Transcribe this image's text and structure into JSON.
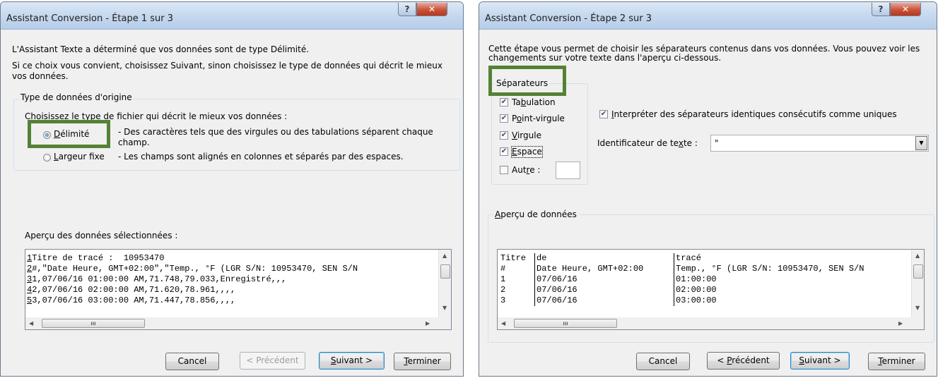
{
  "dialog1": {
    "title": "Assistant Conversion - Étape 1 sur 3",
    "intro1": "L'Assistant Texte a déterminé que vos données sont de type Délimité.",
    "intro2": "Si ce choix vous convient, choisissez Suivant, sinon choisissez le type de données qui décrit le mieux vos données.",
    "group_title": "Type de données d'origine",
    "choose_label": "Choisissez le type de fichier qui décrit le mieux vos données :",
    "option_delimited": {
      "label": "Délimité",
      "desc": "- Des caractères tels que des virgules ou des tabulations séparent chaque champ.",
      "selected": true
    },
    "option_fixed": {
      "label": "Largeur fixe",
      "desc": "- Les champs sont alignés en colonnes et séparés par des espaces.",
      "selected": false
    },
    "preview_label": "Aperçu des données sélectionnées :",
    "preview_rows": [
      {
        "num": "1",
        "text": "Titre de tracé :  10953470"
      },
      {
        "num": "2",
        "text": "#,\"Date Heure, GMT+02:00\",\"Temp., °F (LGR S/N: 10953470, SEN S/N"
      },
      {
        "num": "3",
        "text": "1,07/06/16 01:00:00 AM,71.748,79.033,Enregistré,,,"
      },
      {
        "num": "4",
        "text": "2,07/06/16 02:00:00 AM,71.620,78.961,,,,"
      },
      {
        "num": "5",
        "text": "3,07/06/16 03:00:00 AM,71.447,78.856,,,,"
      }
    ],
    "buttons": {
      "cancel": "Cancel",
      "prev": "< Précédent",
      "next": "Suivant >",
      "finish": "Terminer"
    }
  },
  "dialog2": {
    "title": "Assistant Conversion - Étape 2 sur 3",
    "intro": "Cette étape vous permet de choisir les séparateurs contenus dans vos données. Vous pouvez voir les changements sur votre texte dans l'aperçu ci-dessous.",
    "separators_title": "Séparateurs",
    "separators": [
      {
        "label": "Tabulation",
        "checked": true
      },
      {
        "label": "Point-virgule",
        "checked": true
      },
      {
        "label": "Virgule",
        "checked": true
      },
      {
        "label": "Espace",
        "checked": true
      },
      {
        "label": "Autre :",
        "checked": false
      }
    ],
    "consecutive_label": "Interpréter des séparateurs identiques consécutifs comme uniques",
    "consecutive_checked": true,
    "text_qualifier_label": "Identificateur de texte :",
    "text_qualifier_value": "\"",
    "preview_title": "Aperçu de données",
    "preview_rows": [
      [
        "Titre",
        "de",
        "tracé"
      ],
      [
        "#",
        "Date Heure, GMT+02:00",
        "Temp., °F (LGR S/N: 10953470, SEN S/N"
      ],
      [
        "1",
        "07/06/16",
        "01:00:00"
      ],
      [
        "2",
        "07/06/16",
        "02:00:00"
      ],
      [
        "3",
        "07/06/16",
        "03:00:00"
      ]
    ],
    "buttons": {
      "cancel": "Cancel",
      "prev": "< Précédent",
      "next": "Suivant >",
      "finish": "Terminer"
    }
  },
  "colors": {
    "highlight": "#548235",
    "title_gradient": "#c4d7ee",
    "close": "#c8533a"
  }
}
